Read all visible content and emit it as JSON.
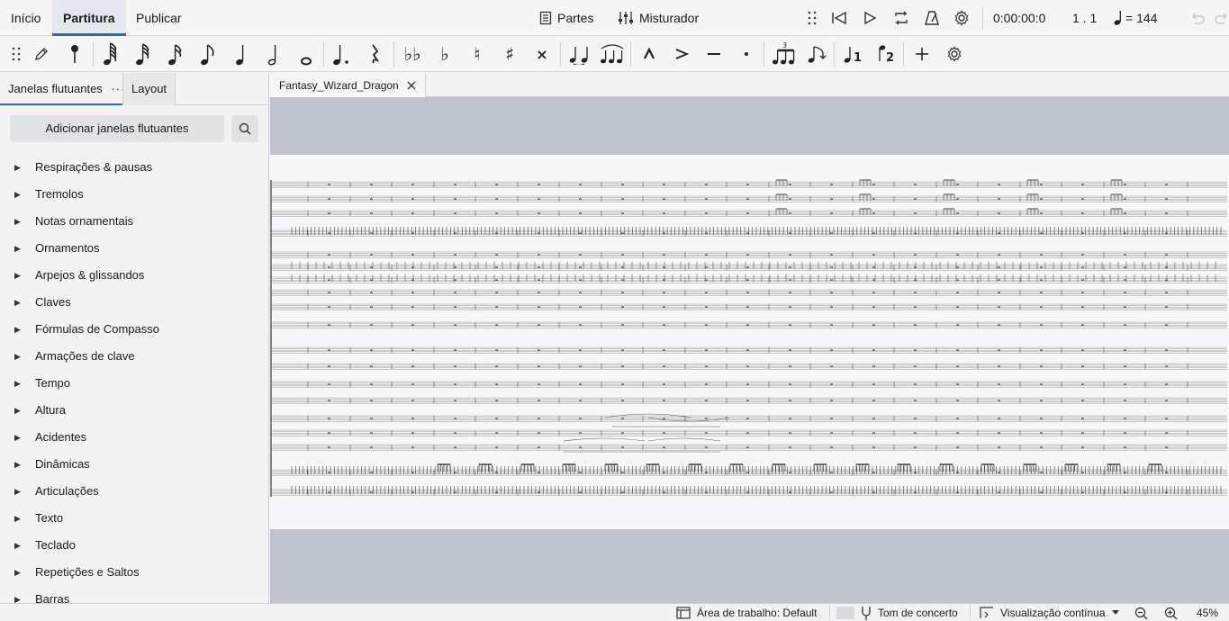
{
  "menu": {
    "tabs": [
      "Início",
      "Partitura",
      "Publicar"
    ],
    "active_tab": "Partitura",
    "parts_label": "Partes",
    "mixer_label": "Misturador",
    "time": "0:00:00:0",
    "position": "1 . 1",
    "tempo": "= 144"
  },
  "toolbar": {
    "tools": [
      "edit-pencil",
      "input-pin",
      "64th-note",
      "32nd-note",
      "16th-note",
      "eighth-note",
      "quarter-note",
      "half-note",
      "whole-note",
      "augmentation-dot",
      "rest",
      "double-flat",
      "flat",
      "natural",
      "sharp",
      "double-sharp",
      "tie",
      "slur",
      "marcato",
      "accent",
      "tenuto",
      "staccato",
      "tuplet",
      "flip-direction",
      "voice-1",
      "voice-2",
      "add",
      "settings"
    ]
  },
  "leftpanel": {
    "tabs": [
      "Janelas flutuantes",
      "Layout"
    ],
    "menu_dots": "···",
    "add_button": "Adicionar janelas flutuantes",
    "items": [
      "Respirações & pausas",
      "Tremolos",
      "Notas ornamentais",
      "Ornamentos",
      "Arpejos & glissandos",
      "Claves",
      "Fórmulas de Compasso",
      "Armações de clave",
      "Tempo",
      "Altura",
      "Acidentes",
      "Dinâmicas",
      "Articulações",
      "Texto",
      "Teclado",
      "Repetições e Saltos",
      "Barras"
    ]
  },
  "document": {
    "tab_title": "Fantasy_Wizard_Dragon"
  },
  "status": {
    "workspace": "Área de trabalho: Default",
    "concert_pitch": "Tom de concerto",
    "view_mode": "Visualização contínua",
    "zoom": "45%"
  },
  "colors": {
    "accent": "#2a66c8",
    "canvas_bg": "#bfc3cc",
    "page_bg": "#f7f7f9"
  }
}
